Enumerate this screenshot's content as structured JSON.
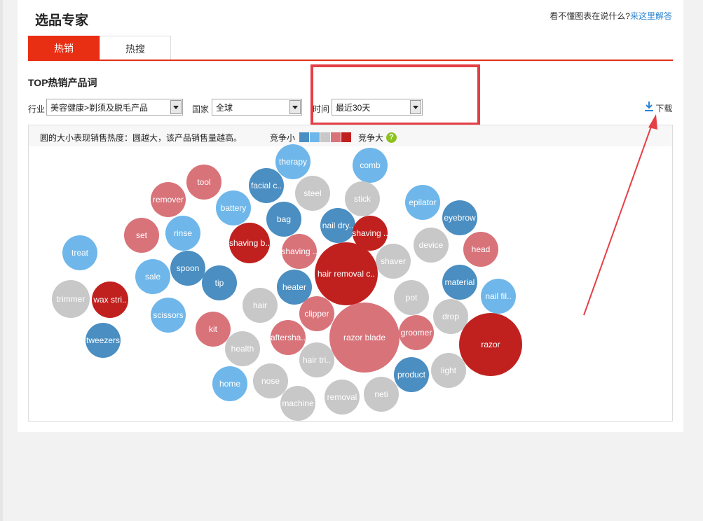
{
  "header": {
    "title": "选品专家",
    "help_prefix": "看不懂图表在说什么?",
    "help_link": "来这里解答"
  },
  "tabs": [
    {
      "label": "热销",
      "active": true
    },
    {
      "label": "热搜",
      "active": false
    }
  ],
  "section": {
    "title": "TOP热销产品词"
  },
  "filters": {
    "industry_label": "行业",
    "industry_value": "美容健康>剃须及脱毛产品",
    "country_label": "国家",
    "country_value": "全球",
    "time_label": "时间",
    "time_value": "最近30天"
  },
  "download": {
    "label": "下载",
    "icon": "download-icon"
  },
  "legend": {
    "description": "圆的大小表现销售热度：圆越大，该产品销售量越高。",
    "low_label": "竞争小",
    "high_label": "竞争大",
    "help": "?",
    "colors": [
      "#4a8ec2",
      "#6fb7ea",
      "#c8c8c8",
      "#d9737a",
      "#c0211f"
    ]
  },
  "colors": {
    "accent": "#e82f13",
    "annotation": "#e53f46",
    "link": "#2a84d2"
  },
  "chart_data": {
    "type": "bubble",
    "encoding": "size = sales heat, color = competition level (0 low to 4 high)",
    "bubbles": [
      {
        "label": "therapy",
        "level": 1
      },
      {
        "label": "comb",
        "level": 1
      },
      {
        "label": "tool",
        "level": 3
      },
      {
        "label": "facial c..",
        "level": 0
      },
      {
        "label": "steel",
        "level": 2
      },
      {
        "label": "stick",
        "level": 2
      },
      {
        "label": "remover",
        "level": 3
      },
      {
        "label": "battery",
        "level": 1
      },
      {
        "label": "epilator",
        "level": 1
      },
      {
        "label": "bag",
        "level": 0
      },
      {
        "label": "nail dry..",
        "level": 0
      },
      {
        "label": "eyebrow",
        "level": 0
      },
      {
        "label": "set",
        "level": 3
      },
      {
        "label": "rinse",
        "level": 1
      },
      {
        "label": "shaving b..",
        "level": 4
      },
      {
        "label": "shaving ..",
        "level": 3
      },
      {
        "label": "device",
        "level": 2
      },
      {
        "label": "treat",
        "level": 1
      },
      {
        "label": "shaving ..",
        "level": 4
      },
      {
        "label": "head",
        "level": 3
      },
      {
        "label": "spoon",
        "level": 0
      },
      {
        "label": "shaver",
        "level": 2
      },
      {
        "label": "sale",
        "level": 1
      },
      {
        "label": "hair removal c..",
        "level": 4
      },
      {
        "label": "tip",
        "level": 0
      },
      {
        "label": "heater",
        "level": 0
      },
      {
        "label": "material",
        "level": 0
      },
      {
        "label": "trimmer",
        "level": 2
      },
      {
        "label": "wax stri..",
        "level": 4
      },
      {
        "label": "pot",
        "level": 2
      },
      {
        "label": "nail fil..",
        "level": 1
      },
      {
        "label": "hair",
        "level": 2
      },
      {
        "label": "clipper",
        "level": 3
      },
      {
        "label": "scissors",
        "level": 1
      },
      {
        "label": "drop",
        "level": 2
      },
      {
        "label": "kit",
        "level": 3
      },
      {
        "label": "groomer",
        "level": 3
      },
      {
        "label": "tweezers",
        "level": 0
      },
      {
        "label": "aftersha..",
        "level": 3
      },
      {
        "label": "razor blade",
        "level": 3
      },
      {
        "label": "razor",
        "level": 4
      },
      {
        "label": "health",
        "level": 2
      },
      {
        "label": "hair tri..",
        "level": 2
      },
      {
        "label": "light",
        "level": 2
      },
      {
        "label": "product",
        "level": 0
      },
      {
        "label": "home",
        "level": 1
      },
      {
        "label": "nose",
        "level": 2
      },
      {
        "label": "removal",
        "level": 2
      },
      {
        "label": "neti",
        "level": 2
      },
      {
        "label": "machine",
        "level": 2
      }
    ]
  }
}
